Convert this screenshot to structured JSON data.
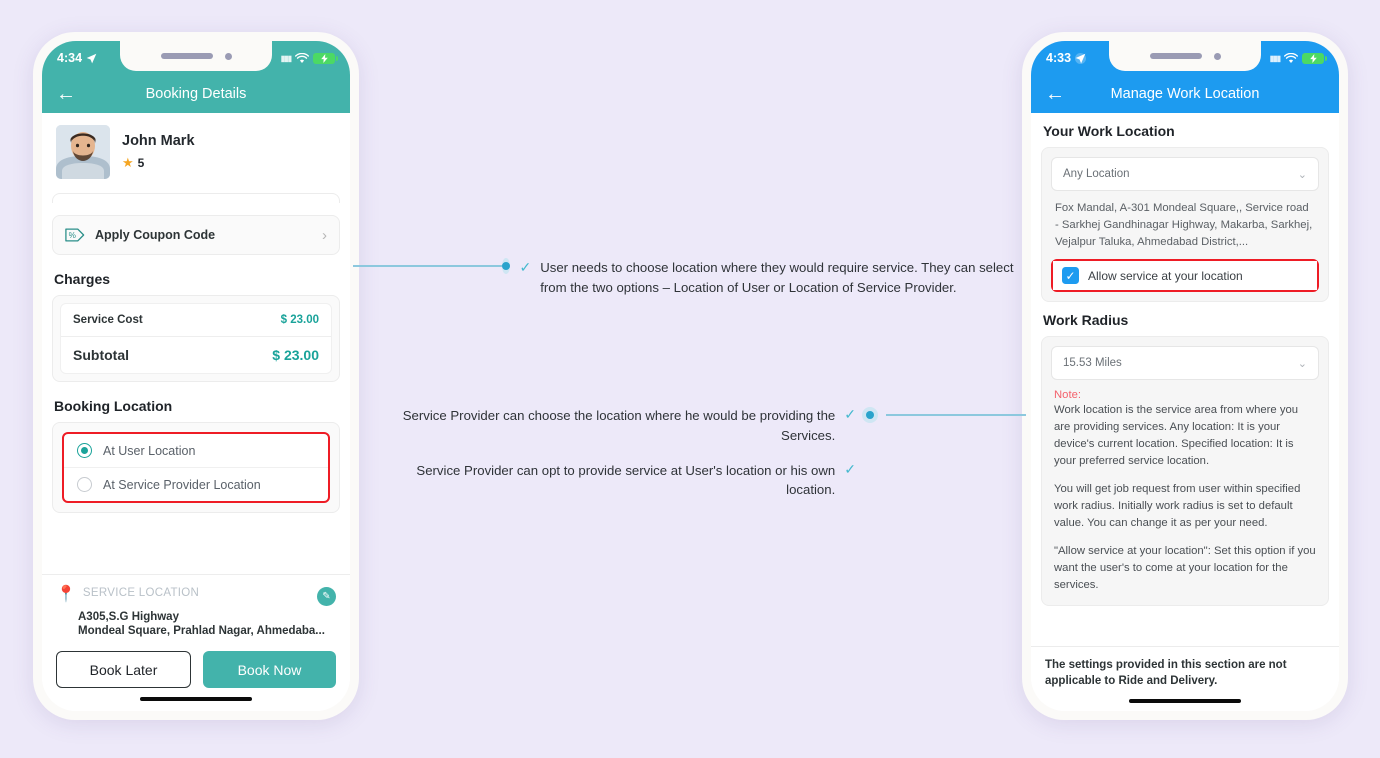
{
  "page": {
    "background_color": "#EDE9F9",
    "accent_teal": "#43b3ab",
    "accent_blue": "#1d9bf0",
    "highlight_red": "#ee1c25",
    "connector_color": "#8cc8de"
  },
  "left_phone": {
    "status_bar": {
      "time": "4:34",
      "location_icon": "location-arrow-icon",
      "signal_icon": "signal-bars-icon",
      "wifi_icon": "wifi-icon",
      "battery_icon": "battery-charging-icon"
    },
    "app_bar": {
      "back_icon": "back-arrow-icon",
      "title": "Booking Details"
    },
    "provider": {
      "avatar": "user-avatar",
      "name": "John Mark",
      "star_icon": "star-icon",
      "rating": "5"
    },
    "coupon": {
      "icon": "coupon-tag-icon",
      "label": "Apply Coupon Code",
      "chevron": "chevron-right-icon"
    },
    "charges": {
      "heading": "Charges",
      "rows": [
        {
          "label": "Service Cost",
          "amount": "$ 23.00"
        },
        {
          "label": "Subtotal",
          "amount": "$ 23.00"
        }
      ]
    },
    "booking_location": {
      "heading": "Booking Location",
      "options": [
        {
          "label": "At User Location",
          "selected": true
        },
        {
          "label": "At Service Provider Location",
          "selected": false
        }
      ]
    },
    "service_location": {
      "pin_icon": "map-pin-icon",
      "label": "SERVICE LOCATION",
      "edit_icon": "edit-location-icon",
      "address_line1": "A305,S.G Highway",
      "address_line2": "Mondeal Square, Prahlad Nagar, Ahmedaba..."
    },
    "actions": {
      "secondary": "Book Later",
      "primary": "Book Now"
    }
  },
  "right_phone": {
    "status_bar": {
      "time": "4:33",
      "location_icon": "location-arrow-icon",
      "signal_icon": "signal-bars-icon",
      "wifi_icon": "wifi-icon",
      "battery_icon": "battery-charging-icon"
    },
    "app_bar": {
      "back_icon": "back-arrow-icon",
      "title": "Manage Work Location"
    },
    "work_location": {
      "heading": "Your Work Location",
      "select_value": "Any Location",
      "chevron": "chevron-down-icon",
      "address": "Fox Mandal, A-301 Mondeal Square,, Service road - Sarkhej Gandhinagar Highway, Makarba, Sarkhej, Vejalpur Taluka, Ahmedabad District,...",
      "checkbox": {
        "label": "Allow service at your location",
        "checked": true
      }
    },
    "work_radius": {
      "heading": "Work Radius",
      "select_value": "15.53 Miles",
      "chevron": "chevron-down-icon",
      "note_title": "Note:",
      "note_paragraphs": [
        "Work location is the service area from where you are providing services. Any location: It is your device's current location. Specified location: It is your preferred service location.",
        "You will get job request from user within specified work radius. Initially work radius is set to default value. You can change it as per your need.",
        "\"Allow service at your location\": Set this option if you want the user's to come at your location for the services."
      ]
    },
    "footer_note": "The settings provided in this section are not applicable to Ride and Delivery."
  },
  "annotations": [
    {
      "id": "anno1",
      "tick_icon": "check-circle-icon",
      "text": "User needs to choose location where they would require service. They can select from the two options – Location of User or Location of Service Provider."
    },
    {
      "id": "anno2a",
      "tick_icon": "check-circle-icon",
      "text": "Service Provider can choose the location where he would be providing the Services."
    },
    {
      "id": "anno2b",
      "tick_icon": "check-circle-icon",
      "text": "Service Provider can opt to provide service at User's location or his own location."
    }
  ]
}
